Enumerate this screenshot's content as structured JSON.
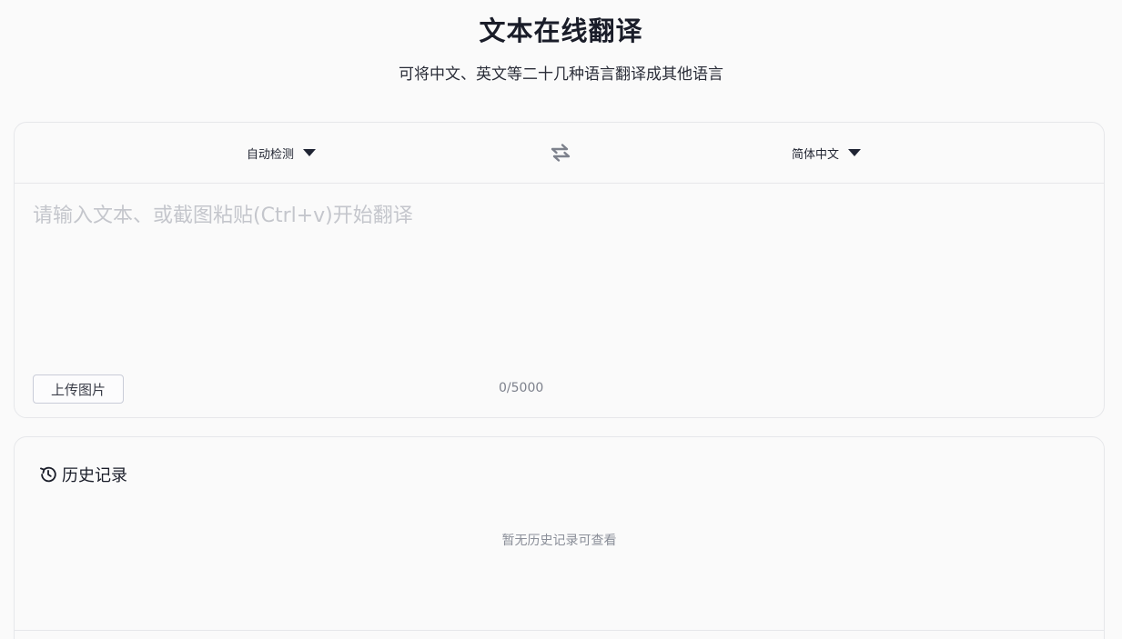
{
  "header": {
    "title": "文本在线翻译",
    "subtitle": "可将中文、英文等二十几种语言翻译成其他语言"
  },
  "translator": {
    "source_language": "自动检测",
    "target_language": "简体中文",
    "input_value": "",
    "input_placeholder": "请输入文本、或截图粘贴(Ctrl+v)开始翻译",
    "upload_label": "上传图片",
    "char_count": "0/5000"
  },
  "history": {
    "title": "历史记录",
    "empty_text": "暂无历史记录可查看"
  },
  "icons": {
    "language_caret": "caret-down-icon",
    "swap": "swap-arrows-icon",
    "history": "history-clock-icon"
  },
  "colors": {
    "background": "#fafafa",
    "border": "#e6e7ea",
    "text_primary": "#1a1d29",
    "placeholder": "#c4c6cc",
    "muted": "#8a8e98",
    "swap_icon": "#7d818c"
  }
}
